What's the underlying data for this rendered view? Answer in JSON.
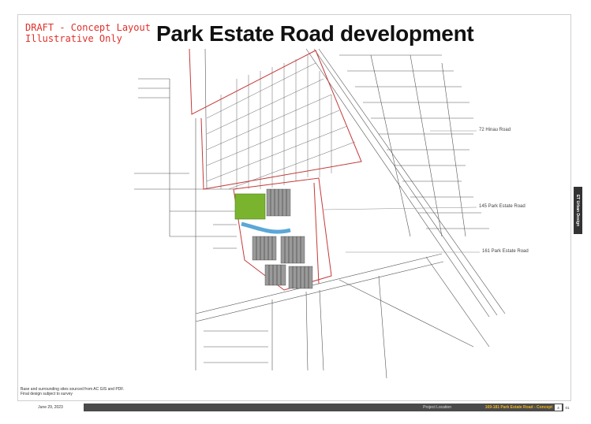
{
  "header": {
    "draft_line1": "DRAFT - Concept Layout",
    "draft_line2": "Illustrative Only",
    "title": "Park Estate Road development"
  },
  "map": {
    "address_labels": [
      "72 Hinau Road",
      "145 Park Estate Road",
      "161 Park Estate Road"
    ],
    "colors": {
      "boundary": "#c43a3a",
      "green_space": "#7ab42f",
      "waterway": "#5ba7d8",
      "new_lots": "#9a9a9a",
      "linework": "#555555"
    }
  },
  "side_tab": "ET Urban Design",
  "source_note": {
    "line1": "Base and surrounding sites sourced from AC GIS and PDF.",
    "line2": "Final design subject to survey"
  },
  "footer": {
    "date": "June 29, 2023",
    "location_label": "Project Location",
    "project": "169-181 Park Estate Road - Concept",
    "page": "4",
    "total": "01"
  }
}
